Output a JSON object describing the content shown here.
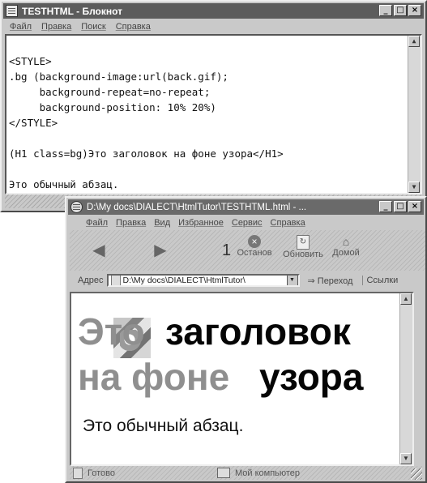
{
  "notepad": {
    "title": "TESTHTML - Блокнот",
    "menu": [
      "Файл",
      "Правка",
      "Поиск",
      "Справка"
    ],
    "lines": [
      "<STYLE>",
      ".bg (background-image:url(back.gif);",
      "     background-repeat=no-repeat;",
      "     background-position: 10% 20%)",
      "</STYLE>",
      "",
      "(H1 class=bg)Это заголовок на фоне узора</H1>",
      "",
      "Это обычный абзац."
    ]
  },
  "browser": {
    "title": "D:\\My docs\\DIALECT\\HtmlTutor\\TESTHTML.html - ...",
    "menu": [
      "Файл",
      "Правка",
      "Вид",
      "Избранное",
      "Сервис",
      "Справка"
    ],
    "toolbar": {
      "stop": "Останов",
      "refresh": "Обновить",
      "home": "Домой",
      "marker": "1"
    },
    "address_label": "Адрес",
    "address_value": "D:\\My docs\\DIALECT\\HtmlTutor\\",
    "go_label": "Переход",
    "links_label": "Ссылки",
    "heading_word1": "Это",
    "heading_word2": "заголовок",
    "heading_word3": "на фоне",
    "heading_word4": "узора",
    "paragraph": "Это обычный абзац.",
    "status_left": "Готово",
    "status_zone": "Мой компьютер"
  }
}
